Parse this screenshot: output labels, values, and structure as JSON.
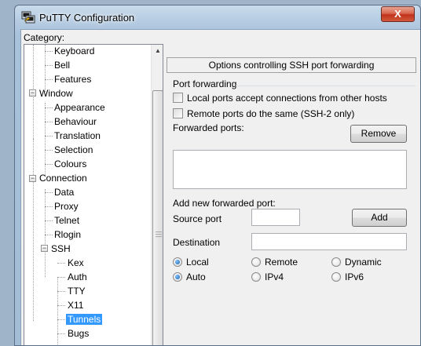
{
  "window": {
    "title": "PuTTY Configuration",
    "close_glyph": "X",
    "icon": "putty-app-icon"
  },
  "category": {
    "label": "Category:",
    "items": [
      {
        "label": "Keyboard"
      },
      {
        "label": "Bell"
      },
      {
        "label": "Features"
      },
      {
        "label": "Window",
        "expander": "−"
      },
      {
        "label": "Appearance"
      },
      {
        "label": "Behaviour"
      },
      {
        "label": "Translation"
      },
      {
        "label": "Selection"
      },
      {
        "label": "Colours"
      },
      {
        "label": "Connection",
        "expander": "−"
      },
      {
        "label": "Data"
      },
      {
        "label": "Proxy"
      },
      {
        "label": "Telnet"
      },
      {
        "label": "Rlogin"
      },
      {
        "label": "SSH",
        "expander": "−"
      },
      {
        "label": "Kex"
      },
      {
        "label": "Auth"
      },
      {
        "label": "TTY"
      },
      {
        "label": "X11"
      },
      {
        "label": "Tunnels",
        "selected": true
      },
      {
        "label": "Bugs"
      }
    ]
  },
  "panel": {
    "header": "Options controlling SSH port forwarding",
    "group_label": "Port forwarding",
    "checkbox_local": "Local ports accept connections from other hosts",
    "checkbox_remote": "Remote ports do the same (SSH-2 only)",
    "forwarded_ports_label": "Forwarded ports:",
    "remove_button": "Remove",
    "add_new_label": "Add new forwarded port:",
    "source_port_label": "Source port",
    "source_port_value": "",
    "add_button": "Add",
    "destination_label": "Destination",
    "destination_value": "",
    "dir_local": "Local",
    "dir_remote": "Remote",
    "dir_dynamic": "Dynamic",
    "ver_auto": "Auto",
    "ver_ipv4": "IPv4",
    "ver_ipv6": "IPv6"
  }
}
